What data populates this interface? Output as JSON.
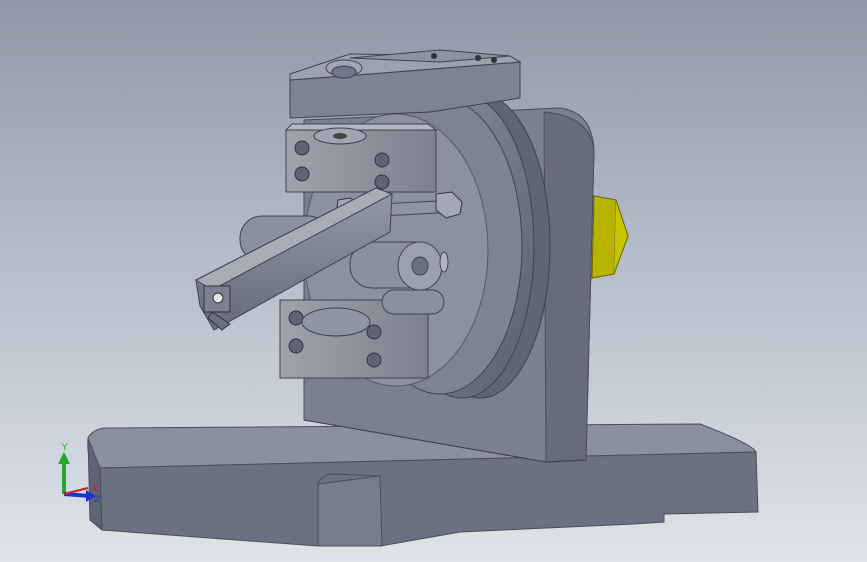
{
  "viewport": {
    "background_top": "#8e98a8",
    "background_bottom": "#dfe3ea",
    "model_color": "#6f7585",
    "highlight_part_color": "#d6d000"
  },
  "triad": {
    "y_label": "Y",
    "x_label": "X",
    "z_label": "Z",
    "y_color": "#22aa22",
    "x_color": "#cc2222",
    "z_color": "#2233cc"
  }
}
